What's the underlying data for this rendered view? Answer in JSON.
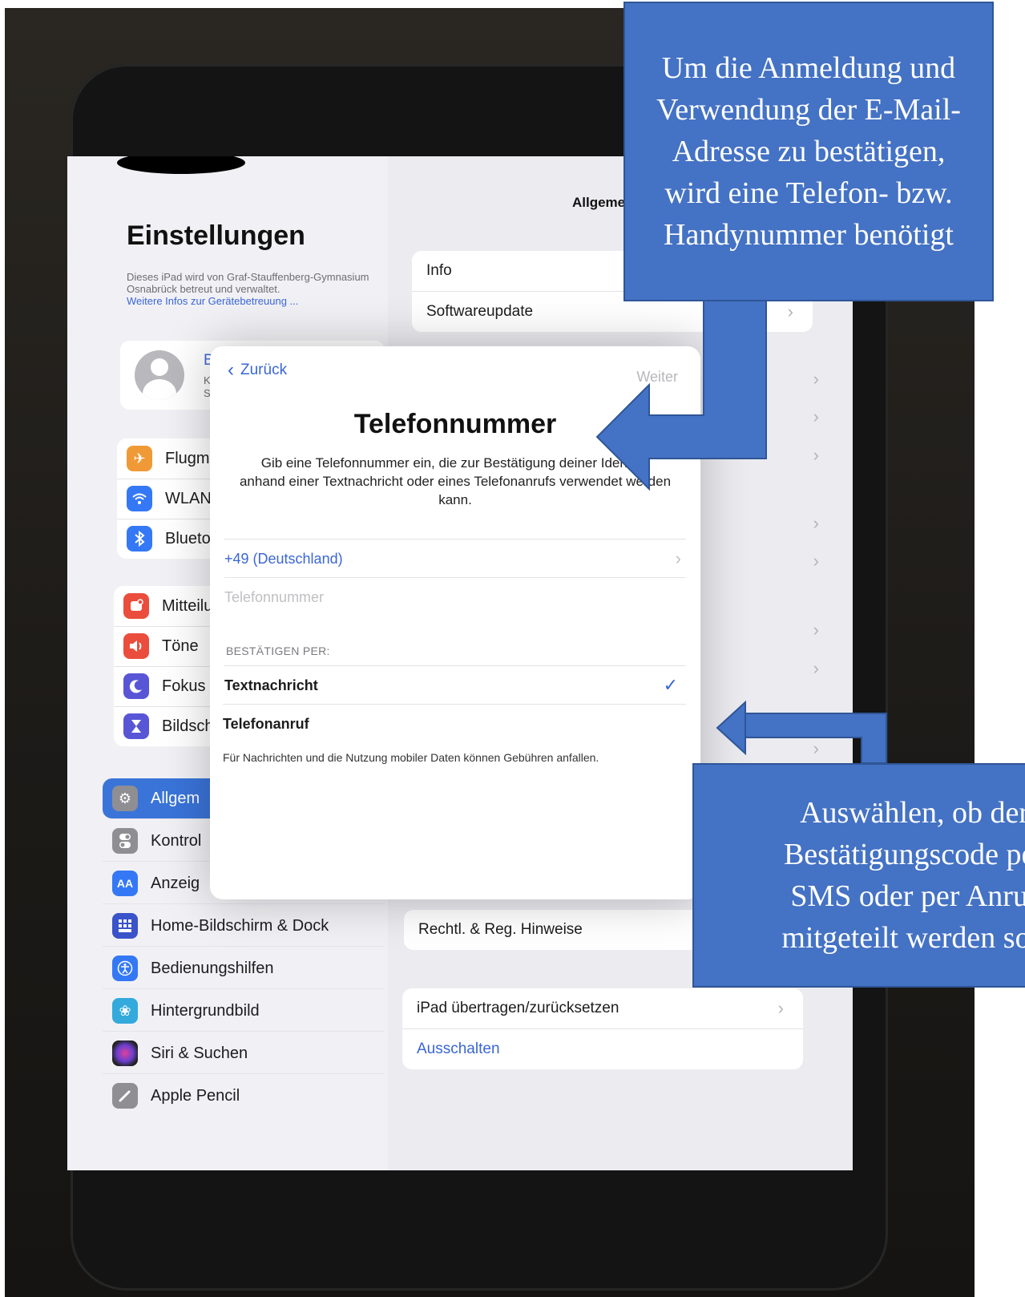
{
  "sidebar": {
    "title": "Einstellungen",
    "mdm_text": "Dieses iPad wird von Graf-Stauffenberg-Gymnasium Osnabrück betreut und verwaltet.",
    "mdm_link": "Weitere Infos zur Gerätebetreuung ...",
    "profile": {
      "name": "Bei",
      "line1": "Kon",
      "line2": "Stor"
    },
    "group1": [
      {
        "label": "Flugmo",
        "icon": "airplane-icon",
        "color": "#f09a37"
      },
      {
        "label": "WLAN",
        "icon": "wifi-icon",
        "color": "#3478f6"
      },
      {
        "label": "Bluetoc",
        "icon": "bluetooth-icon",
        "color": "#3478f6"
      }
    ],
    "group2": [
      {
        "label": "Mitteilu",
        "icon": "notifications-icon",
        "color": "#eb4d3d"
      },
      {
        "label": "Töne",
        "icon": "sounds-icon",
        "color": "#eb4d3d"
      },
      {
        "label": "Fokus",
        "icon": "moon-icon",
        "color": "#5856d6"
      },
      {
        "label": "Bildsch",
        "icon": "hourglass-icon",
        "color": "#5856d6"
      }
    ],
    "group3": [
      {
        "label": "Allgem",
        "icon": "gear-icon",
        "color": "#8e8e93",
        "active": true
      },
      {
        "label": "Kontrol",
        "icon": "toggles-icon",
        "color": "#8e8e93"
      },
      {
        "label": "Anzeig",
        "icon": "display-icon",
        "color": "#3478f6"
      },
      {
        "label": "Home-Bildschirm & Dock",
        "icon": "home-grid-icon",
        "color": "#3a53c9"
      },
      {
        "label": "Bedienungshilfen",
        "icon": "accessibility-icon",
        "color": "#3478f6"
      },
      {
        "label": "Hintergrundbild",
        "icon": "wallpaper-icon",
        "color": "#33a9dc"
      },
      {
        "label": "Siri & Suchen",
        "icon": "siri-icon",
        "color": "#222222"
      },
      {
        "label": "Apple Pencil",
        "icon": "pencil-icon",
        "color": "#8e8e93"
      }
    ]
  },
  "main": {
    "title": "Allgeme",
    "group1": [
      "Info",
      "Softwareupdate"
    ],
    "group_legal": [
      "Rechtl. & Reg. Hinweise"
    ],
    "group_reset": [
      "iPad übertragen/zurücksetzen"
    ],
    "shutdown": "Ausschalten"
  },
  "modal": {
    "back": "Zurück",
    "next": "Weiter",
    "title": "Telefonnummer",
    "description": "Gib eine Telefonnummer ein, die zur Bestätigung deiner Identität anhand einer Textnachricht oder eines Telefonanrufs verwendet werden kann.",
    "country": "+49 (Deutschland)",
    "phone_placeholder": "Telefonnummer",
    "section_header": "BESTÄTIGEN PER:",
    "options": [
      {
        "label": "Textnachricht",
        "selected": true
      },
      {
        "label": "Telefonanruf",
        "selected": false
      }
    ],
    "footer": "Für Nachrichten und die Nutzung mobiler Daten können Gebühren anfallen."
  },
  "callouts": {
    "top": [
      "Um die Anmeldung und",
      "Verwendung der E-Mail-",
      "Adresse zu bestätigen,",
      "wird eine Telefon- bzw.",
      "Handynummer benötigt"
    ],
    "bottom": [
      "Auswählen, ob der",
      "Bestätigungscode per",
      "SMS oder per Anruf",
      "mitgeteilt werden soll"
    ]
  },
  "colors": {
    "accent": "#3a66d6",
    "callout": "#4472c4"
  }
}
